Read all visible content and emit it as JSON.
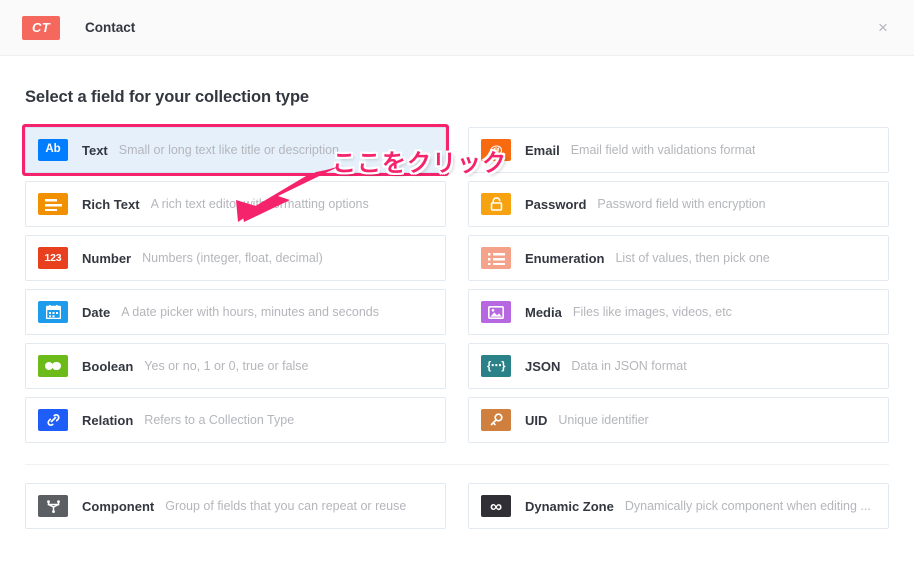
{
  "header": {
    "badge": "CT",
    "title": "Contact",
    "close_label": "×",
    "badge_color": "#f4685e"
  },
  "main": {
    "section_title": "Select a field for your collection type"
  },
  "annotation": {
    "text": "ここをクリック",
    "color": "#f5236b"
  },
  "fields": {
    "left": [
      {
        "icon": "text-ab-icon",
        "glyph": "Ab",
        "color": "#007eff",
        "name": "Text",
        "desc": "Small or long text like title or description",
        "highlighted": true
      },
      {
        "icon": "rich-text-icon",
        "glyph": "☰",
        "color": "#f29100",
        "name": "Rich Text",
        "desc": "A rich text editor with formatting options",
        "highlighted": false
      },
      {
        "icon": "number-123-icon",
        "glyph": "123",
        "color": "#e8401f",
        "name": "Number",
        "desc": "Numbers (integer, float, decimal)",
        "highlighted": false
      },
      {
        "icon": "date-calendar-icon",
        "glyph": "▦",
        "color": "#1c9ceb",
        "name": "Date",
        "desc": "A date picker with hours, minutes and seconds",
        "highlighted": false
      },
      {
        "icon": "boolean-toggle-icon",
        "glyph": "",
        "color": "#6dbb1a",
        "name": "Boolean",
        "desc": "Yes or no, 1 or 0, true or false",
        "highlighted": false
      },
      {
        "icon": "relation-link-icon",
        "glyph": "⚭",
        "color": "#1f5df9",
        "name": "Relation",
        "desc": "Refers to a Collection Type",
        "highlighted": false
      }
    ],
    "right": [
      {
        "icon": "email-at-icon",
        "glyph": "@",
        "color": "#f76a10",
        "name": "Email",
        "desc": "Email field with validations format",
        "highlighted": false
      },
      {
        "icon": "password-lock-icon",
        "glyph": "⚿",
        "color": "#f7a210",
        "name": "Password",
        "desc": "Password field with encryption",
        "highlighted": false
      },
      {
        "icon": "enumeration-list-icon",
        "glyph": "☰",
        "color": "#f5a28a",
        "name": "Enumeration",
        "desc": "List of values, then pick one",
        "highlighted": false
      },
      {
        "icon": "media-image-icon",
        "glyph": "▣",
        "color": "#b767e0",
        "name": "Media",
        "desc": "Files like images, videos, etc",
        "highlighted": false
      },
      {
        "icon": "json-braces-icon",
        "glyph": "{⋯}",
        "color": "#2a8187",
        "name": "JSON",
        "desc": "Data in JSON format",
        "highlighted": false
      },
      {
        "icon": "uid-key-icon",
        "glyph": "⚷",
        "color": "#cf7f3e",
        "name": "UID",
        "desc": "Unique identifier",
        "highlighted": false
      }
    ],
    "bottom": [
      {
        "icon": "component-node-icon",
        "glyph": "⅄",
        "color": "#5b5e63",
        "name": "Component",
        "desc": "Group of fields that you can repeat or reuse",
        "highlighted": false
      },
      {
        "icon": "dynamic-zone-infinity-icon",
        "glyph": "∞",
        "color": "#2f2f35",
        "name": "Dynamic Zone",
        "desc": "Dynamically pick component when editing ...",
        "highlighted": false
      }
    ]
  }
}
